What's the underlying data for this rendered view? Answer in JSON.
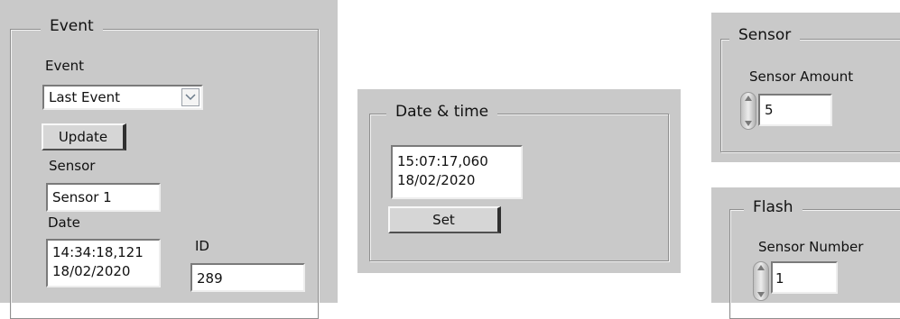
{
  "event_panel": {
    "title": "Event",
    "event_label": "Event",
    "event_select_value": "Last Event",
    "update_button": "Update",
    "sensor_label": "Sensor",
    "sensor_value": "Sensor 1",
    "date_label": "Date",
    "date_value": "14:34:18,121\n18/02/2020",
    "id_label": "ID",
    "id_value": "289"
  },
  "datetime_panel": {
    "title": "Date & time",
    "datetime_value": "15:07:17,060\n18/02/2020",
    "set_button": "Set"
  },
  "sensor_panel": {
    "title": "Sensor",
    "amount_label": "Sensor Amount",
    "amount_value": "5",
    "spinner_icon": "up-down-spinner-icon"
  },
  "flash_panel": {
    "title": "Flash",
    "number_label": "Sensor Number",
    "number_value": "1",
    "spinner_icon": "up-down-spinner-icon"
  },
  "colors": {
    "panel_bg": "#c9c9c9",
    "field_bg": "#ffffff",
    "page_bg": "#ffffff"
  }
}
